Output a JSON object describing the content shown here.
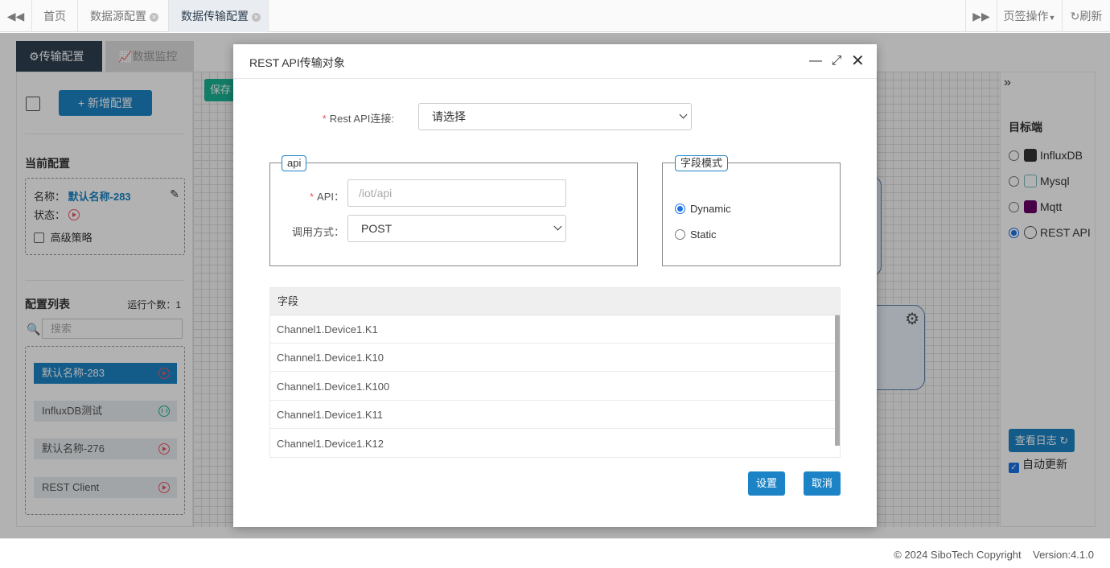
{
  "tabs": {
    "home": "首页",
    "datasource": "数据源配置",
    "transfer": "数据传输配置",
    "page_ops": "页签操作",
    "refresh": "刷新"
  },
  "panel_tabs": {
    "transfer_config": "传输配置",
    "data_monitor": "数据监控"
  },
  "left": {
    "new_config": "+ 新增配置",
    "current_config_title": "当前配置",
    "name_label": "名称：",
    "name_value": "默认名称-283",
    "status_label": "状态：",
    "advanced": "高级策略",
    "list_title": "配置列表",
    "running_count": "运行个数：1",
    "search_placeholder": "搜索",
    "items": [
      {
        "label": "默认名称-283"
      },
      {
        "label": "InfluxDB测试"
      },
      {
        "label": "默认名称-276"
      },
      {
        "label": "REST Client"
      }
    ]
  },
  "canvas": {
    "save": "保存"
  },
  "right": {
    "target_title": "目标端",
    "targets": [
      {
        "label": "InfluxDB",
        "checked": false
      },
      {
        "label": "Mysql",
        "checked": false
      },
      {
        "label": "Mqtt",
        "checked": false
      },
      {
        "label": "REST API",
        "checked": true
      }
    ],
    "view_log": "查看日志",
    "auto_update": "自动更新"
  },
  "modal": {
    "title": "REST API传输对象",
    "conn_label": "Rest API连接:",
    "conn_value": "请选择",
    "api_legend": "api",
    "api_label": "API：",
    "api_placeholder": "/iot/api",
    "method_label": "调用方式：",
    "method_value": "POST",
    "mode_legend": "字段模式",
    "mode_dynamic": "Dynamic",
    "mode_static": "Static",
    "table_header": "字段",
    "rows": [
      "Channel1.Device1.K1",
      "Channel1.Device1.K10",
      "Channel1.Device1.K100",
      "Channel1.Device1.K11",
      "Channel1.Device1.K12"
    ],
    "btn_set": "设置",
    "btn_cancel": "取消"
  },
  "footer": {
    "copyright": "© 2024 SiboTech Copyright",
    "version": "Version:4.1.0"
  }
}
